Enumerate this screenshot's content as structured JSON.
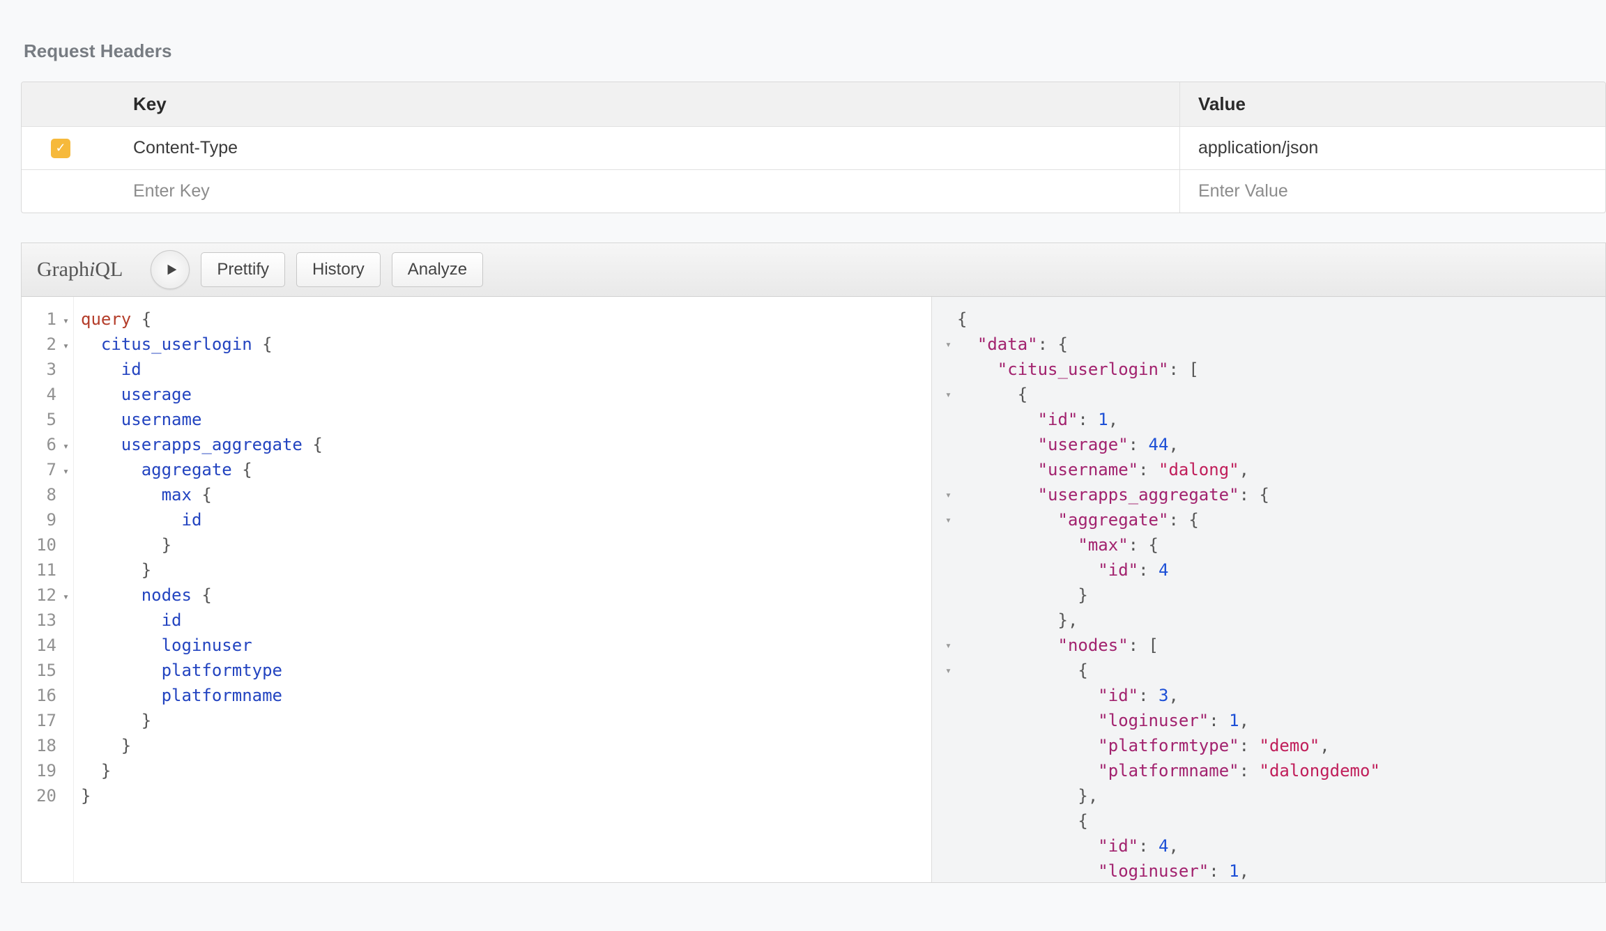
{
  "section_title": "Request Headers",
  "headers_table": {
    "columns": {
      "key": "Key",
      "value": "Value"
    },
    "rows": [
      {
        "checked": true,
        "key": "Content-Type",
        "value": "application/json"
      }
    ],
    "placeholders": {
      "key": "Enter Key",
      "value": "Enter Value"
    }
  },
  "graphiql": {
    "logo": "GraphiQL",
    "buttons": {
      "prettify": "Prettify",
      "history": "History",
      "analyze": "Analyze"
    }
  },
  "query_lines": [
    {
      "n": 1,
      "fold": true,
      "tokens": [
        [
          "kw",
          "query"
        ],
        [
          "punc",
          " {"
        ]
      ]
    },
    {
      "n": 2,
      "fold": true,
      "tokens": [
        [
          "pad",
          "  "
        ],
        [
          "fld",
          "citus_userlogin"
        ],
        [
          "punc",
          " {"
        ]
      ]
    },
    {
      "n": 3,
      "fold": false,
      "tokens": [
        [
          "pad",
          "    "
        ],
        [
          "fld",
          "id"
        ]
      ]
    },
    {
      "n": 4,
      "fold": false,
      "tokens": [
        [
          "pad",
          "    "
        ],
        [
          "fld",
          "userage"
        ]
      ]
    },
    {
      "n": 5,
      "fold": false,
      "tokens": [
        [
          "pad",
          "    "
        ],
        [
          "fld",
          "username"
        ]
      ]
    },
    {
      "n": 6,
      "fold": true,
      "tokens": [
        [
          "pad",
          "    "
        ],
        [
          "fld",
          "userapps_aggregate"
        ],
        [
          "punc",
          " {"
        ]
      ]
    },
    {
      "n": 7,
      "fold": true,
      "tokens": [
        [
          "pad",
          "      "
        ],
        [
          "fld",
          "aggregate"
        ],
        [
          "punc",
          " {"
        ]
      ]
    },
    {
      "n": 8,
      "fold": false,
      "tokens": [
        [
          "pad",
          "        "
        ],
        [
          "fld",
          "max"
        ],
        [
          "punc",
          " {"
        ]
      ]
    },
    {
      "n": 9,
      "fold": false,
      "tokens": [
        [
          "pad",
          "          "
        ],
        [
          "fld",
          "id"
        ]
      ]
    },
    {
      "n": 10,
      "fold": false,
      "tokens": [
        [
          "pad",
          "        "
        ],
        [
          "punc",
          "}"
        ]
      ]
    },
    {
      "n": 11,
      "fold": false,
      "tokens": [
        [
          "pad",
          "      "
        ],
        [
          "punc",
          "}"
        ]
      ]
    },
    {
      "n": 12,
      "fold": true,
      "tokens": [
        [
          "pad",
          "      "
        ],
        [
          "fld",
          "nodes"
        ],
        [
          "punc",
          " {"
        ]
      ]
    },
    {
      "n": 13,
      "fold": false,
      "tokens": [
        [
          "pad",
          "        "
        ],
        [
          "fld",
          "id"
        ]
      ]
    },
    {
      "n": 14,
      "fold": false,
      "tokens": [
        [
          "pad",
          "        "
        ],
        [
          "fld",
          "loginuser"
        ]
      ]
    },
    {
      "n": 15,
      "fold": false,
      "tokens": [
        [
          "pad",
          "        "
        ],
        [
          "fld",
          "platformtype"
        ]
      ]
    },
    {
      "n": 16,
      "fold": false,
      "tokens": [
        [
          "pad",
          "        "
        ],
        [
          "fld",
          "platformname"
        ]
      ]
    },
    {
      "n": 17,
      "fold": false,
      "tokens": [
        [
          "pad",
          "      "
        ],
        [
          "punc",
          "}"
        ]
      ]
    },
    {
      "n": 18,
      "fold": false,
      "tokens": [
        [
          "pad",
          "    "
        ],
        [
          "punc",
          "}"
        ]
      ]
    },
    {
      "n": 19,
      "fold": false,
      "tokens": [
        [
          "pad",
          "  "
        ],
        [
          "punc",
          "}"
        ]
      ]
    },
    {
      "n": 20,
      "fold": false,
      "tokens": [
        [
          "punc",
          "}"
        ]
      ]
    }
  ],
  "result_lines": [
    {
      "fold": false,
      "tokens": [
        [
          "jpun",
          "{"
        ]
      ]
    },
    {
      "fold": true,
      "tokens": [
        [
          "pad",
          "  "
        ],
        [
          "jkey",
          "\"data\""
        ],
        [
          "jpun",
          ": {"
        ]
      ]
    },
    {
      "fold": false,
      "tokens": [
        [
          "pad",
          "    "
        ],
        [
          "jkey",
          "\"citus_userlogin\""
        ],
        [
          "jpun",
          ": ["
        ]
      ]
    },
    {
      "fold": true,
      "tokens": [
        [
          "pad",
          "      "
        ],
        [
          "jpun",
          "{"
        ]
      ]
    },
    {
      "fold": false,
      "tokens": [
        [
          "pad",
          "        "
        ],
        [
          "jkey",
          "\"id\""
        ],
        [
          "jpun",
          ": "
        ],
        [
          "jnum",
          "1"
        ],
        [
          "jpun",
          ","
        ]
      ]
    },
    {
      "fold": false,
      "tokens": [
        [
          "pad",
          "        "
        ],
        [
          "jkey",
          "\"userage\""
        ],
        [
          "jpun",
          ": "
        ],
        [
          "jnum",
          "44"
        ],
        [
          "jpun",
          ","
        ]
      ]
    },
    {
      "fold": false,
      "tokens": [
        [
          "pad",
          "        "
        ],
        [
          "jkey",
          "\"username\""
        ],
        [
          "jpun",
          ": "
        ],
        [
          "jstr",
          "\"dalong\""
        ],
        [
          "jpun",
          ","
        ]
      ]
    },
    {
      "fold": true,
      "tokens": [
        [
          "pad",
          "        "
        ],
        [
          "jkey",
          "\"userapps_aggregate\""
        ],
        [
          "jpun",
          ": {"
        ]
      ]
    },
    {
      "fold": true,
      "tokens": [
        [
          "pad",
          "          "
        ],
        [
          "jkey",
          "\"aggregate\""
        ],
        [
          "jpun",
          ": {"
        ]
      ]
    },
    {
      "fold": false,
      "tokens": [
        [
          "pad",
          "            "
        ],
        [
          "jkey",
          "\"max\""
        ],
        [
          "jpun",
          ": {"
        ]
      ]
    },
    {
      "fold": false,
      "tokens": [
        [
          "pad",
          "              "
        ],
        [
          "jkey",
          "\"id\""
        ],
        [
          "jpun",
          ": "
        ],
        [
          "jnum",
          "4"
        ]
      ]
    },
    {
      "fold": false,
      "tokens": [
        [
          "pad",
          "            "
        ],
        [
          "jpun",
          "}"
        ]
      ]
    },
    {
      "fold": false,
      "tokens": [
        [
          "pad",
          "          "
        ],
        [
          "jpun",
          "},"
        ]
      ]
    },
    {
      "fold": true,
      "tokens": [
        [
          "pad",
          "          "
        ],
        [
          "jkey",
          "\"nodes\""
        ],
        [
          "jpun",
          ": ["
        ]
      ]
    },
    {
      "fold": true,
      "tokens": [
        [
          "pad",
          "            "
        ],
        [
          "jpun",
          "{"
        ]
      ]
    },
    {
      "fold": false,
      "tokens": [
        [
          "pad",
          "              "
        ],
        [
          "jkey",
          "\"id\""
        ],
        [
          "jpun",
          ": "
        ],
        [
          "jnum",
          "3"
        ],
        [
          "jpun",
          ","
        ]
      ]
    },
    {
      "fold": false,
      "tokens": [
        [
          "pad",
          "              "
        ],
        [
          "jkey",
          "\"loginuser\""
        ],
        [
          "jpun",
          ": "
        ],
        [
          "jnum",
          "1"
        ],
        [
          "jpun",
          ","
        ]
      ]
    },
    {
      "fold": false,
      "tokens": [
        [
          "pad",
          "              "
        ],
        [
          "jkey",
          "\"platformtype\""
        ],
        [
          "jpun",
          ": "
        ],
        [
          "jstr",
          "\"demo\""
        ],
        [
          "jpun",
          ","
        ]
      ]
    },
    {
      "fold": false,
      "tokens": [
        [
          "pad",
          "              "
        ],
        [
          "jkey",
          "\"platformname\""
        ],
        [
          "jpun",
          ": "
        ],
        [
          "jstr",
          "\"dalongdemo\""
        ]
      ]
    },
    {
      "fold": false,
      "tokens": [
        [
          "pad",
          "            "
        ],
        [
          "jpun",
          "},"
        ]
      ]
    },
    {
      "fold": false,
      "tokens": [
        [
          "pad",
          "            "
        ],
        [
          "jpun",
          "{"
        ]
      ]
    },
    {
      "fold": false,
      "tokens": [
        [
          "pad",
          "              "
        ],
        [
          "jkey",
          "\"id\""
        ],
        [
          "jpun",
          ": "
        ],
        [
          "jnum",
          "4"
        ],
        [
          "jpun",
          ","
        ]
      ]
    },
    {
      "fold": false,
      "tokens": [
        [
          "pad",
          "              "
        ],
        [
          "jkey",
          "\"loginuser\""
        ],
        [
          "jpun",
          ": "
        ],
        [
          "jnum",
          "1"
        ],
        [
          "jpun",
          ","
        ]
      ]
    }
  ]
}
